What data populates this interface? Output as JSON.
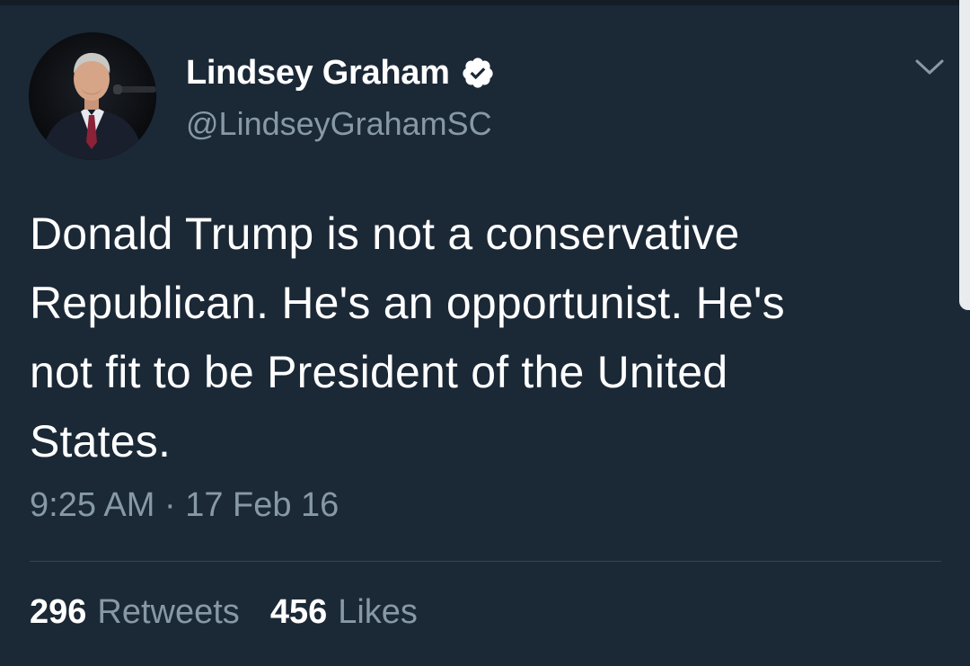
{
  "tweet": {
    "author_name": "Lindsey Graham",
    "author_handle": "@LindseyGrahamSC",
    "verified": true,
    "text_lines": [
      "Donald Trump is not a conservative",
      "Republican. He's an opportunist. He's",
      "not fit to be President of the United",
      "States."
    ],
    "timestamp": "9:25 AM · 17 Feb 16",
    "retweets": {
      "count": "296",
      "label": "Retweets"
    },
    "likes": {
      "count": "456",
      "label": "Likes"
    }
  },
  "icons": {
    "verified": "verified-badge-icon",
    "menu": "chevron-down-icon"
  },
  "colors": {
    "background": "#1b2836",
    "primary_text": "#ffffff",
    "secondary_text": "#8899a6",
    "divider": "#38444d"
  }
}
